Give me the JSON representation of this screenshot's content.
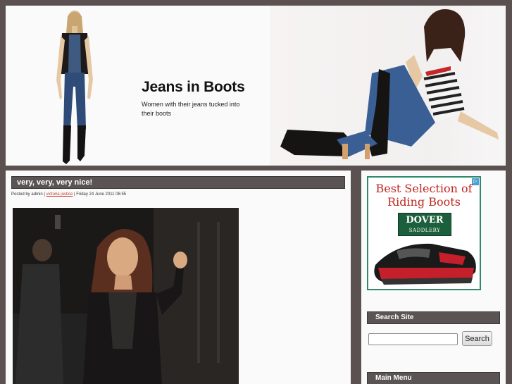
{
  "site": {
    "title": "Jeans in Boots",
    "tagline": "Women with their jeans tucked into their boots"
  },
  "post": {
    "title": "very, very, very nice!",
    "meta": {
      "posted_by_prefix": "Posted by ",
      "author": "admin",
      "separator_1": " | ",
      "tag": "victoria justice",
      "separator_2": " | ",
      "date": "Friday 24 June 2011 06:55"
    }
  },
  "sidebar": {
    "ad": {
      "headline": "Best Selection of Riding Boots",
      "brand_line1": "DOVER",
      "brand_line2": "SADDLERY",
      "choices_icon": "adchoices-icon"
    },
    "search": {
      "heading": "Search Site",
      "input_value": "",
      "button_label": "Search"
    },
    "menu": {
      "heading": "Main Menu"
    }
  },
  "colors": {
    "page_background": "#5a5150",
    "bar_background": "#5b5454",
    "panel_background": "#fafafa",
    "ad_headline": "#c0271f",
    "ad_brand": "#1c5f3c",
    "tag_link": "#c0392b"
  }
}
